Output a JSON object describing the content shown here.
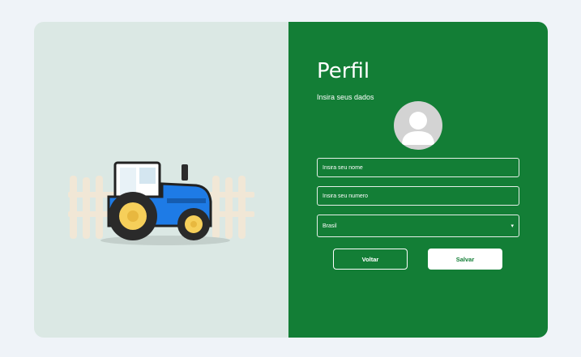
{
  "form": {
    "title": "Perfil",
    "subtitle": "Insira seus dados",
    "name_placeholder": "Insira seu nome",
    "number_placeholder": "Insira seu numero",
    "country_selected": "Brasil",
    "back_label": "Voltar",
    "save_label": "Salvar"
  },
  "icons": {
    "avatar": "user-avatar-icon",
    "dropdown": "chevron-down-icon",
    "illustration": "tractor-illustration"
  },
  "colors": {
    "panel_green": "#137e36",
    "left_panel_bg": "#dbe8e4",
    "page_bg": "#eff3f8",
    "tractor_blue": "#1e7be6",
    "wheel_yellow": "#f6cf5a"
  }
}
